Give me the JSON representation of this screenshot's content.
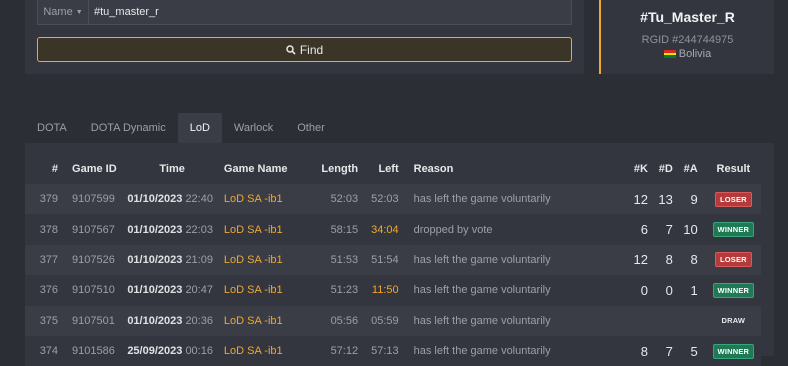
{
  "search": {
    "field_select": "Name",
    "value": "#tu_master_r",
    "find_label": "Find"
  },
  "profile": {
    "name": "#Tu_Master_R",
    "rgid": "RGID #244744975",
    "country": "Bolivia",
    "flag_colors": [
      "#d52b1e",
      "#f9e300",
      "#007934"
    ]
  },
  "tabs": [
    {
      "label": "DOTA",
      "active": false
    },
    {
      "label": "DOTA Dynamic",
      "active": false
    },
    {
      "label": "LoD",
      "active": true
    },
    {
      "label": "Warlock",
      "active": false
    },
    {
      "label": "Other",
      "active": false
    }
  ],
  "table": {
    "headers": {
      "num": "#",
      "game_id": "Game ID",
      "time": "Time",
      "game_name": "Game Name",
      "length": "Length",
      "left": "Left",
      "reason": "Reason",
      "k": "#K",
      "d": "#D",
      "a": "#A",
      "result": "Result"
    },
    "rows": [
      {
        "num": "379",
        "game_id": "9107599",
        "date": "01/10/2023",
        "clock": "22:40",
        "game_name": "LoD SA -ib1",
        "length": "52:03",
        "left": "52:03",
        "left_warn": false,
        "reason": "has left the game voluntarily",
        "k": "12",
        "d": "13",
        "a": "9",
        "result": "LOSER"
      },
      {
        "num": "378",
        "game_id": "9107567",
        "date": "01/10/2023",
        "clock": "22:03",
        "game_name": "LoD SA -ib1",
        "length": "58:15",
        "left": "34:04",
        "left_warn": true,
        "reason": "dropped by vote",
        "k": "6",
        "d": "7",
        "a": "10",
        "result": "WINNER"
      },
      {
        "num": "377",
        "game_id": "9107526",
        "date": "01/10/2023",
        "clock": "21:09",
        "game_name": "LoD SA -ib1",
        "length": "51:53",
        "left": "51:54",
        "left_warn": false,
        "reason": "has left the game voluntarily",
        "k": "12",
        "d": "8",
        "a": "8",
        "result": "LOSER"
      },
      {
        "num": "376",
        "game_id": "9107510",
        "date": "01/10/2023",
        "clock": "20:47",
        "game_name": "LoD SA -ib1",
        "length": "51:23",
        "left": "11:50",
        "left_warn": true,
        "reason": "has left the game voluntarily",
        "k": "0",
        "d": "0",
        "a": "1",
        "result": "WINNER"
      },
      {
        "num": "375",
        "game_id": "9107501",
        "date": "01/10/2023",
        "clock": "20:36",
        "game_name": "LoD SA -ib1",
        "length": "05:56",
        "left": "05:59",
        "left_warn": false,
        "reason": "has left the game voluntarily",
        "k": "",
        "d": "",
        "a": "",
        "result": "DRAW"
      },
      {
        "num": "374",
        "game_id": "9101586",
        "date": "25/09/2023",
        "clock": "00:16",
        "game_name": "LoD SA -ib1",
        "length": "57:12",
        "left": "57:13",
        "left_warn": false,
        "reason": "has left the game voluntarily",
        "k": "8",
        "d": "7",
        "a": "5",
        "result": "WINNER"
      }
    ]
  }
}
